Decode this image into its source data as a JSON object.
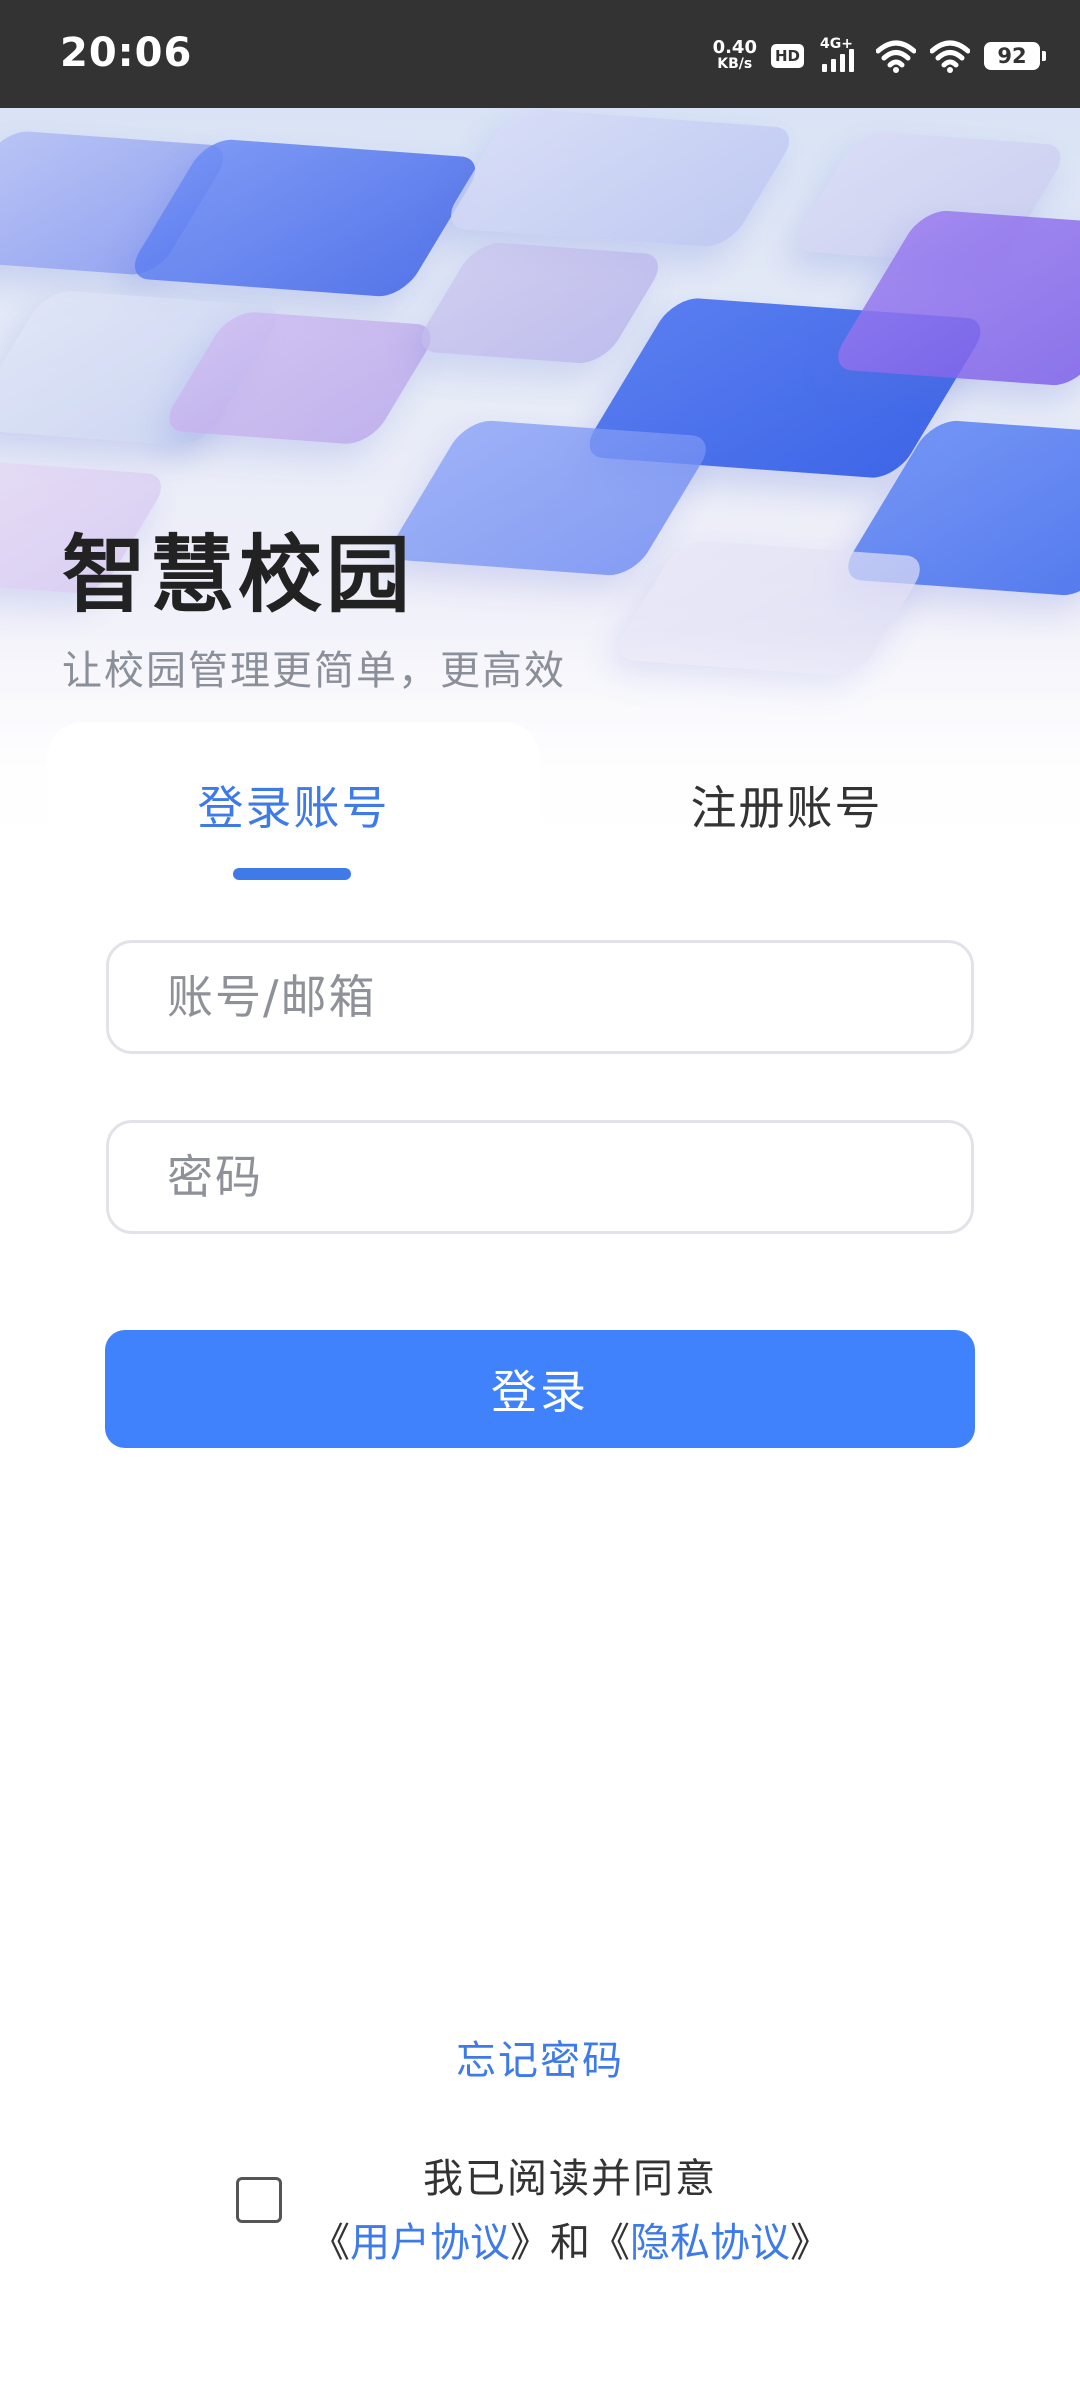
{
  "status_bar": {
    "time": "20:06",
    "net_speed_value": "0.40",
    "net_speed_unit": "KB/s",
    "hd_badge": "HD",
    "network_type": "4G+",
    "battery": "92"
  },
  "header": {
    "title": "智慧校园",
    "subtitle": "让校园管理更简单，更高效"
  },
  "tabs": {
    "login": "登录账号",
    "register": "注册账号",
    "active": "login"
  },
  "form": {
    "account_placeholder": "账号/邮箱",
    "account_value": "",
    "password_placeholder": "密码",
    "password_value": "",
    "login_button": "登录"
  },
  "footer": {
    "forgot_password": "忘记密码",
    "agree_text": "我已阅读并同意",
    "open_bracket": "《",
    "close_bracket": "》",
    "user_agreement": "用户协议",
    "and": "和",
    "privacy_policy": "隐私协议",
    "agreed": false
  },
  "colors": {
    "accent": "#3e7be9",
    "button": "#3f82fb",
    "status_bar": "#333333"
  }
}
